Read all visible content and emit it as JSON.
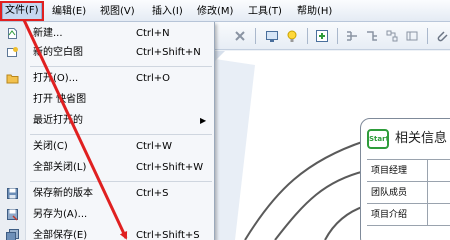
{
  "menubar": {
    "items": [
      {
        "label": "文件(F)"
      },
      {
        "label": "编辑(E)"
      },
      {
        "label": "视图(V)"
      },
      {
        "label": "插入(I)"
      },
      {
        "label": "修改(M)"
      },
      {
        "label": "工具(T)"
      },
      {
        "label": "帮助(H)"
      }
    ]
  },
  "file_menu": {
    "items": [
      {
        "label": "新建...",
        "shortcut": "Ctrl+N",
        "icon": "new-file-icon"
      },
      {
        "label": "新的空白图",
        "shortcut": "Ctrl+Shift+N",
        "icon": "blank-map-icon"
      },
      {
        "label": "打开(O)...",
        "shortcut": "Ctrl+O",
        "icon": "open-folder-icon"
      },
      {
        "label": "打开 快省图",
        "shortcut": "",
        "icon": ""
      },
      {
        "label": "最近打开的",
        "shortcut": "",
        "icon": "",
        "submenu": "▶"
      },
      {
        "label": "关闭(C)",
        "shortcut": "Ctrl+W",
        "icon": ""
      },
      {
        "label": "全部关闭(L)",
        "shortcut": "Ctrl+Shift+W",
        "icon": ""
      },
      {
        "label": "保存新的版本",
        "shortcut": "Ctrl+S",
        "icon": "save-icon"
      },
      {
        "label": "另存为(A)...",
        "shortcut": "",
        "icon": "save-as-icon"
      },
      {
        "label": "全部保存(E)",
        "shortcut": "Ctrl+Shift+S",
        "icon": "save-all-icon"
      }
    ]
  },
  "topic": {
    "badge": "Start",
    "title": "相关信息",
    "rows": [
      {
        "label": "项目经理"
      },
      {
        "label": "团队成员"
      },
      {
        "label": "项目介绍"
      }
    ]
  },
  "colors": {
    "highlight": "#e02020",
    "menu_bg": "#f5f7fa",
    "canvas_bg": "#e8eef6",
    "badge": "#2e9c3a"
  }
}
